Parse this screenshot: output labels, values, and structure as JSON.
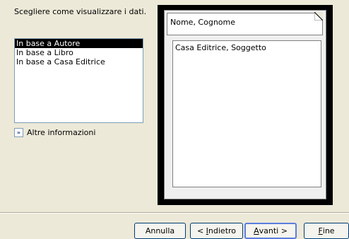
{
  "prompt": "Scegliere come visualizzare i dati.",
  "list": {
    "items": [
      {
        "label": "In base a Autore",
        "selected": true
      },
      {
        "label": "In base a Libro",
        "selected": false
      },
      {
        "label": "In base a Casa Editrice",
        "selected": false
      }
    ]
  },
  "more_info": {
    "icon": "double-chevron-right-icon",
    "label": "Altre informazioni"
  },
  "preview": {
    "header_field": "Nome, Cognome",
    "body_field": "Casa Editrice, Soggetto"
  },
  "buttons": {
    "cancel": "Annulla",
    "back_prefix": "< ",
    "back_mnemonic": "I",
    "back_rest": "ndietro",
    "next_mnemonic": "A",
    "next_rest": "vanti >",
    "finish_mnemonic": "F",
    "finish_rest": "ine"
  }
}
